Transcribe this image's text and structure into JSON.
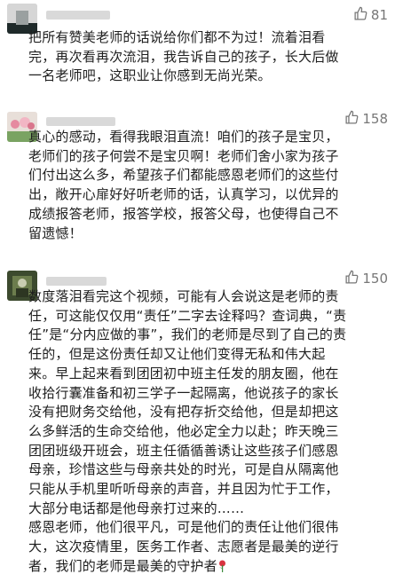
{
  "comments": [
    {
      "likes": "81",
      "text": "把所有赞美老师的话说给你们都不为过！流着泪看\n完，再次看再次流泪，我告诉自己的孩子，长大后做\n一名老师吧，这职业让你感到无尚光荣。"
    },
    {
      "likes": "158",
      "text": "真心的感动，看得我眼泪直流！咱们的孩子是宝贝，\n老师们的孩子何尝不是宝贝啊！老师们舍小家为孩子\n们付出这么多，希望孩子们都能感恩老师们的这些付\n出，敞开心扉好好听老师的话，认真学习，以优异的\n成绩报答老师，报答学校，报答父母，也使得自己不\n留遗憾！"
    },
    {
      "likes": "150",
      "text": "数度落泪看完这个视频，可能有人会说这是老师的责\n任，可这能仅仅用“责任”二字去诠释吗？查词典，“责\n任”是“分内应做的事”，我们的老师是尽到了自己的责\n任的，但是这份责任却又让他们变得无私和伟大起\n来。早上起来看到团团初中班主任发的朋友圈，他在\n收拾行囊准备和初三学子一起隔离，他说孩子的家长\n没有把财务交给他，没有把存折交给他，但是却把这\n么多鲜活的生命交给他，他必定全力以赴；昨天晚三\n团团班级开班会，班主任循循善诱让这些孩子们感恩\n母亲，珍惜这些与母亲共处的时光，可是自从隔离他\n只能从手机里听听母亲的声音，并且因为忙于工作，\n大部分电话都是他母亲打过来的……\n感恩老师，他们很平凡，可是他们的责任让他们很伟\n大，这次疫情里，医务工作者、志愿者是最美的逆行\n者，我们的老师是最美的守护者"
    }
  ]
}
